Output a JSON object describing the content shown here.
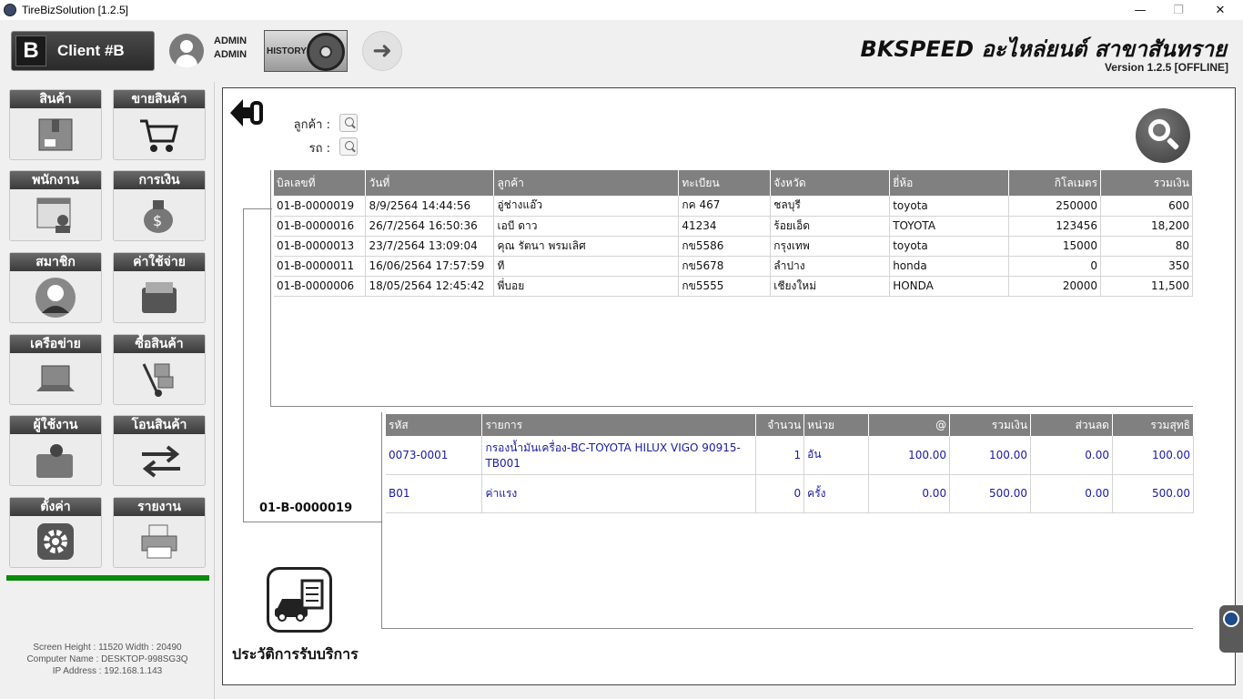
{
  "window": {
    "title": "TireBizSolution  [1.2.5]",
    "minimize_glyph": "—",
    "restore_glyph": "❐",
    "close_glyph": "✕"
  },
  "header": {
    "client_letter": "B",
    "client_name": "Client #B",
    "user_line1": "ADMIN",
    "user_line2": "ADMIN",
    "history_label": "HISTORY",
    "next_glyph": "➜",
    "shop_name": "BKSPEED อะไหล่ยนต์ สาขาสันทราย",
    "version": "Version 1.2.5 [OFFLINE]"
  },
  "sidebar": {
    "tiles": [
      {
        "label": "สินค้า",
        "icon": "product-box-icon"
      },
      {
        "label": "ขายสินค้า",
        "icon": "shopping-cart-icon"
      },
      {
        "label": "พนักงาน",
        "icon": "employee-icon"
      },
      {
        "label": "การเงิน",
        "icon": "money-bag-icon"
      },
      {
        "label": "สมาชิก",
        "icon": "member-icon"
      },
      {
        "label": "ค่าใช้จ่าย",
        "icon": "wallet-icon"
      },
      {
        "label": "เครือข่าย",
        "icon": "laptop-icon"
      },
      {
        "label": "ซื้อสินค้า",
        "icon": "hand-truck-icon"
      },
      {
        "label": "ผู้ใช้งาน",
        "icon": "user-folder-icon"
      },
      {
        "label": "โอนสินค้า",
        "icon": "transfer-arrows-icon"
      },
      {
        "label": "ตั้งค่า",
        "icon": "gear-icon"
      },
      {
        "label": "รายงาน",
        "icon": "printer-icon"
      }
    ],
    "screen_info": "Screen Height : 11520 Width : 20490",
    "computer_name": "Computer Name : DESKTOP-998SG3Q",
    "ip_address": "IP Address : 192.168.1.143"
  },
  "filters": {
    "customer_label": "ลูกค้า :",
    "vehicle_label": "รถ :"
  },
  "invoice_table": {
    "columns": [
      "บิลเลขที่",
      "วันที่",
      "ลูกค้า",
      "ทะเบียน",
      "จังหวัด",
      "ยี่ห้อ",
      "กิโลเมตร",
      "รวมเงิน"
    ],
    "rows": [
      [
        "01-B-0000019",
        "8/9/2564 14:44:56",
        "อู่ช่างแอ๊ว",
        "กค 467",
        "ชลบุรี",
        "toyota",
        "250000",
        "600"
      ],
      [
        "01-B-0000016",
        "26/7/2564 16:50:36",
        "เอบี ดาว",
        "41234",
        "ร้อยเอ็ด",
        "TOYOTA",
        "123456",
        "18,200"
      ],
      [
        "01-B-0000013",
        "23/7/2564 13:09:04",
        "คุณ รัตนา พรมเลิศ",
        "กข5586",
        "กรุงเทพ",
        "toyota",
        "15000",
        "80"
      ],
      [
        "01-B-0000011",
        "16/06/2564 17:57:59",
        "ที",
        "กข5678",
        "ลำปาง",
        "honda",
        "0",
        "350"
      ],
      [
        "01-B-0000006",
        "18/05/2564 12:45:42",
        "พี่บอย",
        "กข5555",
        "เชียงใหม่",
        "HONDA",
        "20000",
        "11,500"
      ]
    ]
  },
  "selected_invoice": "01-B-0000019",
  "detail_table": {
    "columns": [
      "รหัส",
      "รายการ",
      "จำนวน",
      "หน่วย",
      "@",
      "รวมเงิน",
      "ส่วนลด",
      "รวมสุทธิ"
    ],
    "rows": [
      [
        "0073-0001",
        "กรองน้ำมันเครื่อง-BC-TOYOTA HILUX VIGO 90915-TB001",
        "1",
        "อัน",
        "100.00",
        "100.00",
        "0.00",
        "100.00"
      ],
      [
        "B01",
        "ค่าแรง",
        "0",
        "ครั้ง",
        "0.00",
        "500.00",
        "0.00",
        "500.00"
      ]
    ]
  },
  "service_history_label": "ประวัติการรับบริการ"
}
